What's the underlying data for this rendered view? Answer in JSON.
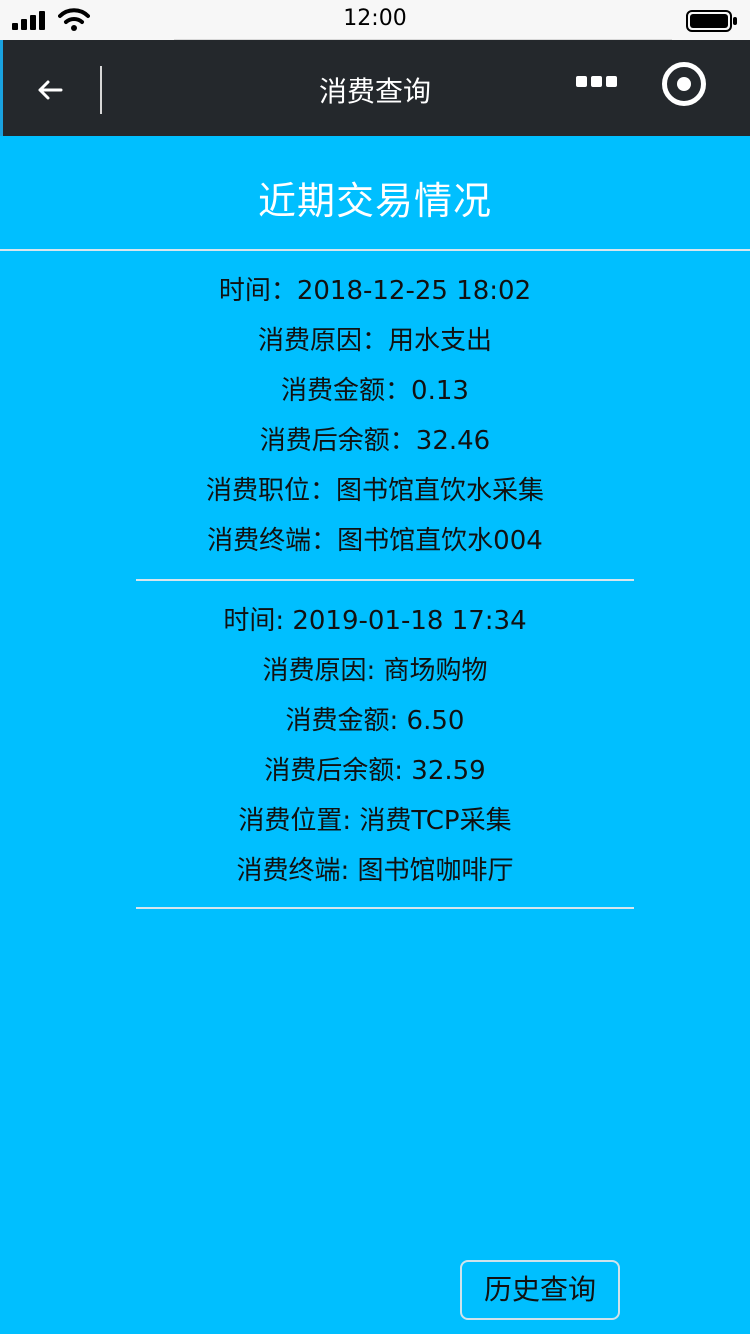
{
  "status_bar": {
    "time": "12:00"
  },
  "nav": {
    "title": "消费查询"
  },
  "main": {
    "heading": "近期交易情况",
    "records": [
      {
        "time": "时间：2018-12-25 18:02",
        "reason": "消费原因：用水支出",
        "amount": "消费金额：0.13",
        "balance": "消费后余额：32.46",
        "location": "消费职位：图书馆直饮水采集",
        "terminal": "消费终端：图书馆直饮水004"
      },
      {
        "time": "时间: 2019-01-18 17:34",
        "reason": "消费原因: 商场购物",
        "amount": "消费金额: 6.50",
        "balance": "消费后余额: 32.59",
        "location": "消费位置: 消费TCP采集",
        "terminal": "消费终端: 图书馆咖啡厅"
      }
    ],
    "history_button": "历史查询"
  }
}
